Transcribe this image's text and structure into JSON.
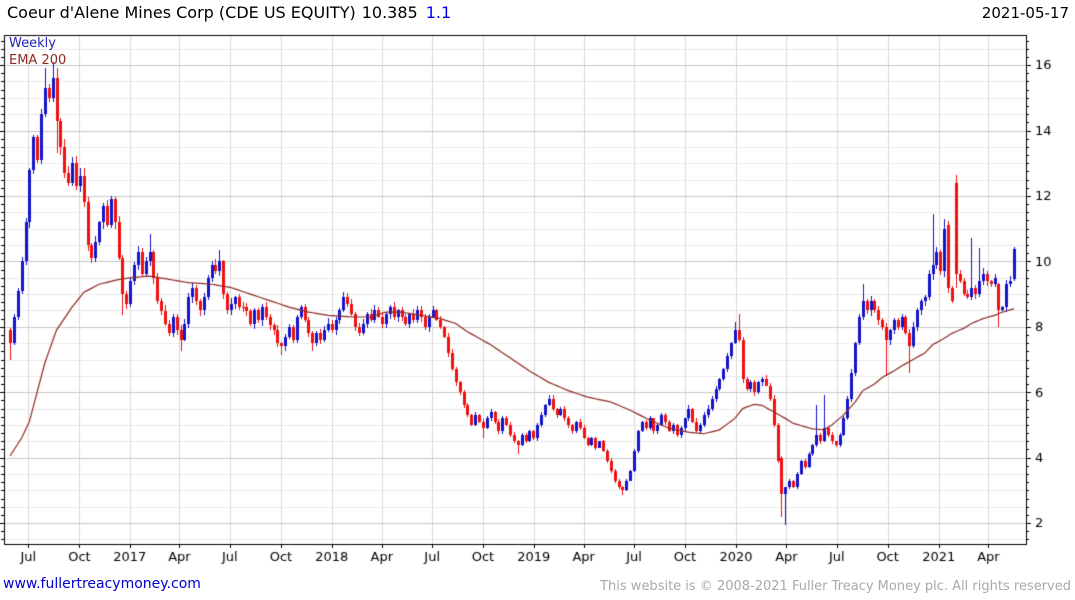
{
  "header": {
    "title": "Coeur d'Alene Mines Corp (CDE US EQUITY)",
    "price": "10.385",
    "change": "1.1",
    "date": "2021-05-17"
  },
  "legend": {
    "timeframe_label": "Weekly",
    "ema_label": "EMA 200"
  },
  "footer": {
    "site_link": "www.fullertreacymoney.com",
    "copyright": "This website is © 2008-2021 Fuller Treacy Money plc. All rights reserved"
  },
  "colors": {
    "up_candle": "#1414cc",
    "down_candle": "#ee1111",
    "ema_line": "#8e2a23",
    "grid_minor": "#ebebeb",
    "grid_major": "#c9c9c9",
    "grid_vertical": "#d9d9d9",
    "frame": "#000000",
    "axis_text": "#000000"
  },
  "chart_data": {
    "type": "candlestick",
    "title": "Coeur d'Alene Mines Corp (CDE US EQUITY)",
    "interval": "Weekly",
    "overlay": "EMA 200",
    "last_price": 10.385,
    "change": 1.1,
    "as_of": "2021-05-17",
    "start_date": "2016-05-30",
    "end_date": "2021-05-17",
    "weeks": 260,
    "y_ticks": [
      2,
      4,
      6,
      8,
      10,
      12,
      14,
      16
    ],
    "y_minor_step": 0.5,
    "y_min": 1.36,
    "y_max": 16.92,
    "grid": true,
    "legend_position": "top-left",
    "x_ticks": [
      {
        "label": "Jul",
        "i": 4.7
      },
      {
        "label": "Oct",
        "i": 17.9
      },
      {
        "label": "2017",
        "i": 30.9
      },
      {
        "label": "Apr",
        "i": 43.7
      },
      {
        "label": "Jul",
        "i": 56.7
      },
      {
        "label": "Oct",
        "i": 69.9
      },
      {
        "label": "2018",
        "i": 83.0
      },
      {
        "label": "Apr",
        "i": 95.9
      },
      {
        "label": "Jul",
        "i": 108.9
      },
      {
        "label": "Oct",
        "i": 122.0
      },
      {
        "label": "2019",
        "i": 135.1
      },
      {
        "label": "Apr",
        "i": 148.0
      },
      {
        "label": "Jul",
        "i": 161.0
      },
      {
        "label": "Oct",
        "i": 174.1
      },
      {
        "label": "2020",
        "i": 187.3
      },
      {
        "label": "Apr",
        "i": 200.3
      },
      {
        "label": "Jul",
        "i": 213.3
      },
      {
        "label": "Oct",
        "i": 226.4
      },
      {
        "label": "2021",
        "i": 239.6
      },
      {
        "label": "Apr",
        "i": 252.4
      }
    ],
    "close_anchors": [
      [
        0,
        7.5
      ],
      [
        1,
        8.3
      ],
      [
        2,
        9.1
      ],
      [
        3,
        10.0
      ],
      [
        4,
        11.2
      ],
      [
        5,
        12.8
      ],
      [
        6,
        13.8
      ],
      [
        7,
        13.1
      ],
      [
        8,
        14.5
      ],
      [
        9,
        15.3
      ],
      [
        10,
        15.0
      ],
      [
        11,
        15.6
      ],
      [
        12,
        14.3
      ],
      [
        13,
        13.5
      ],
      [
        14,
        12.7
      ],
      [
        15,
        12.4
      ],
      [
        16,
        13.0
      ],
      [
        17,
        12.3
      ],
      [
        18,
        12.6
      ],
      [
        19,
        11.8
      ],
      [
        20,
        10.5
      ],
      [
        21,
        10.1
      ],
      [
        22,
        10.6
      ],
      [
        23,
        11.2
      ],
      [
        24,
        11.7
      ],
      [
        25,
        11.1
      ],
      [
        26,
        11.9
      ],
      [
        27,
        11.2
      ],
      [
        28,
        10.1
      ],
      [
        29,
        9.0
      ],
      [
        30,
        8.7
      ],
      [
        31,
        9.4
      ],
      [
        32,
        9.9
      ],
      [
        33,
        10.3
      ],
      [
        34,
        9.6
      ],
      [
        35,
        10.0
      ],
      [
        36,
        10.3
      ],
      [
        37,
        9.5
      ],
      [
        38,
        8.8
      ],
      [
        40,
        8.1
      ],
      [
        41,
        7.8
      ],
      [
        42,
        8.3
      ],
      [
        43,
        7.9
      ],
      [
        44,
        7.6
      ],
      [
        45,
        8.1
      ],
      [
        46,
        8.9
      ],
      [
        47,
        9.2
      ],
      [
        48,
        8.8
      ],
      [
        49,
        8.5
      ],
      [
        50,
        8.9
      ],
      [
        51,
        9.5
      ],
      [
        52,
        9.9
      ],
      [
        53,
        9.7
      ],
      [
        54,
        10.0
      ],
      [
        55,
        9.0
      ],
      [
        56,
        8.5
      ],
      [
        57,
        8.7
      ],
      [
        58,
        8.9
      ],
      [
        60,
        8.6
      ],
      [
        62,
        8.1
      ],
      [
        63,
        8.5
      ],
      [
        64,
        8.2
      ],
      [
        65,
        8.6
      ],
      [
        66,
        8.3
      ],
      [
        68,
        7.9
      ],
      [
        69,
        7.5
      ],
      [
        70,
        7.4
      ],
      [
        71,
        7.7
      ],
      [
        72,
        8.0
      ],
      [
        73,
        7.6
      ],
      [
        74,
        8.3
      ],
      [
        75,
        8.6
      ],
      [
        76,
        8.2
      ],
      [
        77,
        7.8
      ],
      [
        78,
        7.5
      ],
      [
        79,
        7.8
      ],
      [
        80,
        7.6
      ],
      [
        81,
        7.9
      ],
      [
        82,
        8.1
      ],
      [
        83,
        7.9
      ],
      [
        84,
        8.2
      ],
      [
        85,
        8.5
      ],
      [
        86,
        8.9
      ],
      [
        87,
        8.7
      ],
      [
        88,
        8.4
      ],
      [
        89,
        8.0
      ],
      [
        90,
        7.8
      ],
      [
        91,
        8.1
      ],
      [
        92,
        8.4
      ],
      [
        93,
        8.2
      ],
      [
        94,
        8.5
      ],
      [
        95,
        8.3
      ],
      [
        96,
        8.1
      ],
      [
        97,
        8.4
      ],
      [
        98,
        8.6
      ],
      [
        99,
        8.3
      ],
      [
        100,
        8.5
      ],
      [
        101,
        8.3
      ],
      [
        102,
        8.1
      ],
      [
        103,
        8.4
      ],
      [
        104,
        8.2
      ],
      [
        105,
        8.5
      ],
      [
        106,
        8.3
      ],
      [
        107,
        8.0
      ],
      [
        108,
        8.3
      ],
      [
        109,
        8.5
      ],
      [
        110,
        8.2
      ],
      [
        111,
        8.0
      ],
      [
        112,
        7.7
      ],
      [
        113,
        7.2
      ],
      [
        114,
        6.7
      ],
      [
        115,
        6.3
      ],
      [
        116,
        6.0
      ],
      [
        117,
        5.6
      ],
      [
        118,
        5.3
      ],
      [
        119,
        5.0
      ],
      [
        120,
        5.3
      ],
      [
        121,
        5.1
      ],
      [
        122,
        4.9
      ],
      [
        123,
        5.2
      ],
      [
        124,
        5.4
      ],
      [
        125,
        5.1
      ],
      [
        126,
        4.8
      ],
      [
        127,
        5.2
      ],
      [
        128,
        5.0
      ],
      [
        129,
        4.7
      ],
      [
        130,
        4.5
      ],
      [
        131,
        4.4
      ],
      [
        132,
        4.7
      ],
      [
        133,
        4.5
      ],
      [
        134,
        4.8
      ],
      [
        135,
        4.6
      ],
      [
        136,
        5.0
      ],
      [
        137,
        5.3
      ],
      [
        138,
        5.6
      ],
      [
        139,
        5.8
      ],
      [
        140,
        5.5
      ],
      [
        141,
        5.3
      ],
      [
        142,
        5.5
      ],
      [
        143,
        5.2
      ],
      [
        144,
        5.0
      ],
      [
        145,
        4.8
      ],
      [
        146,
        5.1
      ],
      [
        147,
        4.9
      ],
      [
        148,
        4.6
      ],
      [
        149,
        4.4
      ],
      [
        150,
        4.6
      ],
      [
        151,
        4.3
      ],
      [
        152,
        4.5
      ],
      [
        153,
        4.2
      ],
      [
        154,
        3.9
      ],
      [
        155,
        3.6
      ],
      [
        156,
        3.3
      ],
      [
        157,
        3.1
      ],
      [
        158,
        3.0
      ],
      [
        159,
        3.3
      ],
      [
        160,
        3.6
      ],
      [
        161,
        4.2
      ],
      [
        162,
        4.8
      ],
      [
        163,
        5.1
      ],
      [
        164,
        4.9
      ],
      [
        165,
        5.2
      ],
      [
        166,
        4.8
      ],
      [
        167,
        5.0
      ],
      [
        168,
        5.3
      ],
      [
        169,
        5.1
      ],
      [
        170,
        4.8
      ],
      [
        171,
        5.0
      ],
      [
        172,
        4.7
      ],
      [
        173,
        4.9
      ],
      [
        174,
        5.2
      ],
      [
        175,
        5.5
      ],
      [
        176,
        5.1
      ],
      [
        177,
        4.8
      ],
      [
        178,
        5.0
      ],
      [
        179,
        5.3
      ],
      [
        180,
        5.5
      ],
      [
        181,
        5.8
      ],
      [
        182,
        6.1
      ],
      [
        183,
        6.4
      ],
      [
        184,
        6.7
      ],
      [
        185,
        7.1
      ],
      [
        186,
        7.5
      ],
      [
        187,
        7.9
      ],
      [
        188,
        7.6
      ],
      [
        189,
        6.4
      ],
      [
        190,
        6.1
      ],
      [
        191,
        6.3
      ],
      [
        192,
        6.0
      ],
      [
        193,
        6.3
      ],
      [
        194,
        6.4
      ],
      [
        195,
        6.2
      ],
      [
        196,
        5.8
      ],
      [
        197,
        5.0
      ],
      [
        198,
        3.9
      ],
      [
        199,
        2.9
      ],
      [
        200,
        3.1
      ],
      [
        201,
        3.3
      ],
      [
        202,
        3.1
      ],
      [
        203,
        3.5
      ],
      [
        204,
        3.9
      ],
      [
        205,
        3.7
      ],
      [
        206,
        4.1
      ],
      [
        207,
        4.4
      ],
      [
        208,
        4.7
      ],
      [
        209,
        4.5
      ],
      [
        210,
        4.9
      ],
      [
        211,
        4.7
      ],
      [
        212,
        4.5
      ],
      [
        213,
        4.4
      ],
      [
        214,
        4.7
      ],
      [
        215,
        5.2
      ],
      [
        216,
        5.8
      ],
      [
        217,
        6.6
      ],
      [
        218,
        7.5
      ],
      [
        219,
        8.3
      ],
      [
        220,
        8.8
      ],
      [
        221,
        8.5
      ],
      [
        222,
        8.8
      ],
      [
        223,
        8.5
      ],
      [
        224,
        8.2
      ],
      [
        225,
        8.0
      ],
      [
        226,
        7.6
      ],
      [
        227,
        7.9
      ],
      [
        228,
        8.2
      ],
      [
        229,
        8.0
      ],
      [
        230,
        8.3
      ],
      [
        231,
        7.8
      ],
      [
        232,
        7.4
      ],
      [
        233,
        8.0
      ],
      [
        234,
        8.5
      ],
      [
        235,
        8.8
      ],
      [
        236,
        8.9
      ],
      [
        237,
        9.6
      ],
      [
        238,
        9.9
      ],
      [
        239,
        10.3
      ],
      [
        240,
        9.7
      ],
      [
        241,
        11.0
      ],
      [
        242,
        9.2
      ],
      [
        243,
        8.8
      ],
      [
        244,
        9.6
      ],
      [
        245,
        9.4
      ],
      [
        246,
        9.0
      ],
      [
        247,
        8.9
      ],
      [
        248,
        9.2
      ],
      [
        249,
        9.0
      ],
      [
        250,
        9.4
      ],
      [
        251,
        9.6
      ],
      [
        252,
        9.4
      ],
      [
        253,
        9.3
      ],
      [
        254,
        9.5
      ],
      [
        255,
        8.5
      ],
      [
        256,
        8.6
      ],
      [
        257,
        9.3
      ],
      [
        258,
        9.4
      ],
      [
        259,
        10.385
      ]
    ],
    "ohlc_overrides": {
      "0": {
        "o": 7.9,
        "l": 7.0
      },
      "9": {
        "h": 15.9
      },
      "11": {
        "h": 16.1
      },
      "12": {
        "l": 13.3
      },
      "29": {
        "l": 8.35
      },
      "36": {
        "h": 10.85
      },
      "44": {
        "l": 7.25
      },
      "54": {
        "h": 10.35
      },
      "70": {
        "l": 7.15
      },
      "78": {
        "l": 7.25
      },
      "122": {
        "l": 4.6
      },
      "131": {
        "l": 4.1
      },
      "139": {
        "h": 5.9
      },
      "158": {
        "l": 2.85
      },
      "175": {
        "h": 5.6
      },
      "187": {
        "h": 8.15
      },
      "188": {
        "h": 8.4
      },
      "199": {
        "o": 4.0,
        "l": 2.2
      },
      "200": {
        "l": 1.94
      },
      "208": {
        "h": 5.6
      },
      "210": {
        "h": 5.9
      },
      "220": {
        "h": 9.3
      },
      "226": {
        "l": 6.5
      },
      "232": {
        "l": 6.6
      },
      "238": {
        "h": 11.45
      },
      "241": {
        "h": 11.3
      },
      "242": {
        "o": 11.1
      },
      "244": {
        "o": 12.4,
        "h": 12.64,
        "l": 9.2
      },
      "248": {
        "h": 10.7
      },
      "250": {
        "h": 10.4
      },
      "255": {
        "o": 9.3,
        "l": 8.0
      },
      "259": {
        "o": 9.45,
        "h": 10.45,
        "l": 9.4
      }
    },
    "ema_anchors": [
      [
        0,
        4.05
      ],
      [
        3,
        4.6
      ],
      [
        5,
        5.1
      ],
      [
        7,
        6.0
      ],
      [
        9,
        6.9
      ],
      [
        12,
        7.9
      ],
      [
        16,
        8.6
      ],
      [
        19,
        9.05
      ],
      [
        23,
        9.3
      ],
      [
        27,
        9.42
      ],
      [
        31,
        9.5
      ],
      [
        36,
        9.55
      ],
      [
        41,
        9.45
      ],
      [
        46,
        9.35
      ],
      [
        52,
        9.3
      ],
      [
        57,
        9.2
      ],
      [
        62,
        9.0
      ],
      [
        67,
        8.8
      ],
      [
        72,
        8.6
      ],
      [
        77,
        8.45
      ],
      [
        82,
        8.35
      ],
      [
        88,
        8.3
      ],
      [
        93,
        8.3
      ],
      [
        97,
        8.45
      ],
      [
        101,
        8.45
      ],
      [
        106,
        8.35
      ],
      [
        111,
        8.25
      ],
      [
        115,
        8.1
      ],
      [
        118,
        7.85
      ],
      [
        124,
        7.45
      ],
      [
        129,
        7.05
      ],
      [
        134,
        6.65
      ],
      [
        139,
        6.3
      ],
      [
        144,
        6.05
      ],
      [
        149,
        5.85
      ],
      [
        155,
        5.7
      ],
      [
        160,
        5.45
      ],
      [
        165,
        5.15
      ],
      [
        170,
        4.9
      ],
      [
        175,
        4.78
      ],
      [
        179,
        4.73
      ],
      [
        183,
        4.85
      ],
      [
        187,
        5.2
      ],
      [
        189,
        5.5
      ],
      [
        192,
        5.63
      ],
      [
        194,
        5.6
      ],
      [
        197,
        5.4
      ],
      [
        200,
        5.2
      ],
      [
        202,
        5.05
      ],
      [
        205,
        4.95
      ],
      [
        207,
        4.88
      ],
      [
        210,
        4.85
      ],
      [
        212,
        5.0
      ],
      [
        215,
        5.3
      ],
      [
        218,
        5.7
      ],
      [
        220,
        6.05
      ],
      [
        223,
        6.25
      ],
      [
        225,
        6.45
      ],
      [
        228,
        6.65
      ],
      [
        230,
        6.8
      ],
      [
        233,
        7.0
      ],
      [
        236,
        7.2
      ],
      [
        238,
        7.45
      ],
      [
        241,
        7.65
      ],
      [
        243,
        7.8
      ],
      [
        246,
        7.95
      ],
      [
        248,
        8.1
      ],
      [
        251,
        8.25
      ],
      [
        254,
        8.35
      ],
      [
        256,
        8.45
      ],
      [
        259,
        8.55
      ]
    ]
  }
}
